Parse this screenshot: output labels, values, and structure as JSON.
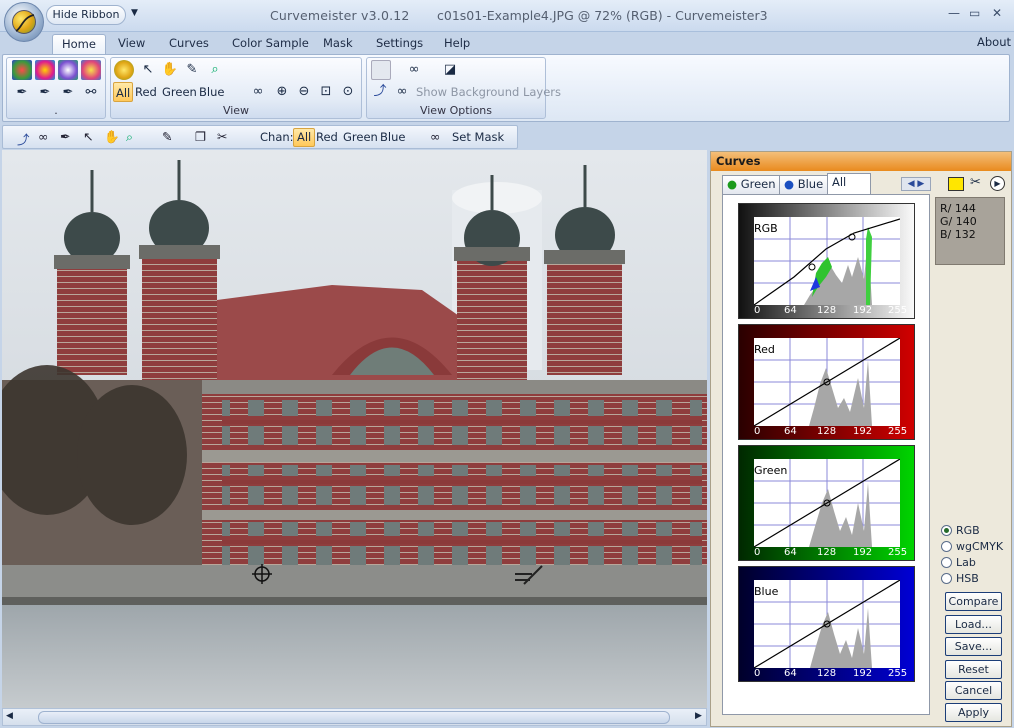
{
  "window": {
    "app_title": "Curvemeister v3.0.12",
    "doc_title": "c01s01-Example4.JPG @ 72% (RGB) - Curvemeister3",
    "hide_ribbon_label": "Hide Ribbon",
    "minimize_glyph": "—",
    "restore_glyph": "▭",
    "close_glyph": "✕"
  },
  "tabs": [
    "Home",
    "View",
    "Curves",
    "Color Sample",
    "Mask",
    "Settings",
    "Help"
  ],
  "about_label": "About",
  "ribbon": {
    "group1_label": ".",
    "view_group": {
      "label": "View",
      "channels": [
        "All",
        "Red",
        "Green",
        "Blue"
      ]
    },
    "view_options": {
      "label": "View Options",
      "show_bg_label": "Show Background Layers"
    }
  },
  "toolbar": {
    "chan_label": "Chan:",
    "channels": [
      "All",
      "Red",
      "Green",
      "Blue"
    ],
    "set_mask_label": "Set Mask"
  },
  "curves_panel": {
    "title": "Curves",
    "tabs": [
      "Green",
      "Blue",
      "All"
    ],
    "graphs": [
      {
        "name": "RGB",
        "bg": "#ffffff",
        "border": "#7a7a7a"
      },
      {
        "name": "Red",
        "bg": "#7a0000",
        "border": "#cc0000"
      },
      {
        "name": "Green",
        "bg": "#007a00",
        "border": "#00cc00"
      },
      {
        "name": "Blue",
        "bg": "#00007a",
        "border": "#0000cc"
      }
    ],
    "ticks": [
      "0",
      "64",
      "128",
      "192",
      "255"
    ],
    "readout": {
      "r": "R/ 144",
      "g": "G/ 140",
      "b": "B/ 132"
    },
    "color_modes": [
      "RGB",
      "wgCMYK",
      "Lab",
      "HSB"
    ],
    "buttons": [
      "Compare",
      "Load...",
      "Save...",
      "Reset",
      "Cancel",
      "Apply"
    ]
  }
}
